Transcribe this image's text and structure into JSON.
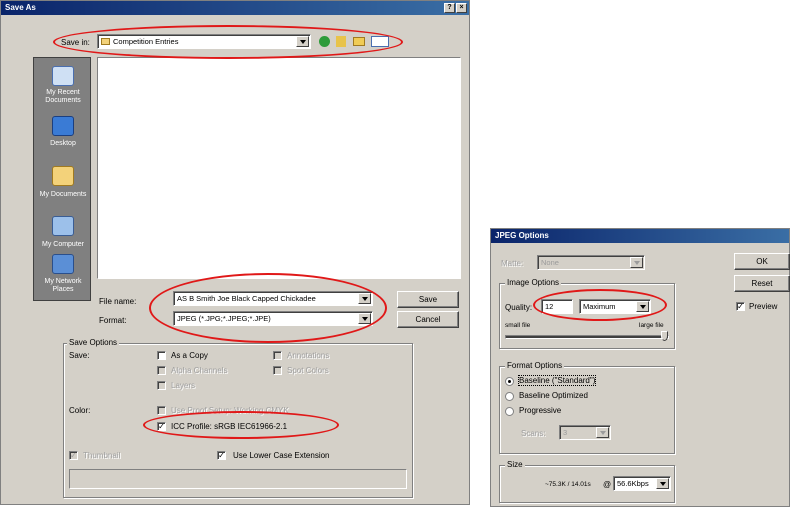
{
  "save_as": {
    "title": "Save As",
    "title_buttons": {
      "help": "?",
      "close": "×"
    },
    "save_in_label": "Save in:",
    "save_in_value": "Competition Entries",
    "places": [
      {
        "label": "My Recent Documents",
        "icon": "recent-documents-icon"
      },
      {
        "label": "Desktop",
        "icon": "desktop-icon"
      },
      {
        "label": "My Documents",
        "icon": "my-documents-icon"
      },
      {
        "label": "My Computer",
        "icon": "my-computer-icon"
      },
      {
        "label": "My Network Places",
        "icon": "network-places-icon"
      }
    ],
    "file_name_label": "File name:",
    "file_name_value": "AS B Smith Joe Black Capped Chickadee",
    "format_label": "Format:",
    "format_value": "JPEG (*.JPG;*.JPEG;*.JPE)",
    "save_button": "Save",
    "cancel_button": "Cancel",
    "save_options": {
      "group_title": "Save Options",
      "save_label": "Save:",
      "as_a_copy": "As a Copy",
      "annotations": "Annotations",
      "alpha_channels": "Alpha Channels",
      "spot_colors": "Spot Colors",
      "layers": "Layers",
      "color_label": "Color:",
      "use_proof_setup": "Use Proof Setup:  Working CMYK",
      "icc_profile": "ICC Profile:  sRGB IEC61966-2.1",
      "thumbnail": "Thumbnail",
      "use_lower_case": "Use Lower Case Extension"
    }
  },
  "jpeg_options": {
    "title": "JPEG Options",
    "matte_label": "Matte:",
    "matte_value": "None",
    "image_options_title": "Image Options",
    "quality_label": "Quality:",
    "quality_value": "12",
    "quality_preset": "Maximum",
    "small_file": "small file",
    "large_file": "large file",
    "quality_slider_level": 12,
    "quality_slider_max": 12,
    "format_options_title": "Format Options",
    "baseline_standard": "Baseline (\"Standard\")",
    "baseline_optimized": "Baseline Optimized",
    "progressive": "Progressive",
    "scans_label": "Scans:",
    "scans_value": "3",
    "size_title": "Size",
    "size_estimate": "~75.3K / 14.01s",
    "size_at": "@",
    "speed_value": "56.6Kbps",
    "ok_button": "OK",
    "reset_button": "Reset",
    "preview_label": "Preview"
  },
  "colors": {
    "title_bar": "#0a246a",
    "dialog_bg": "#d4d0c8",
    "annotation": "#e01818"
  }
}
